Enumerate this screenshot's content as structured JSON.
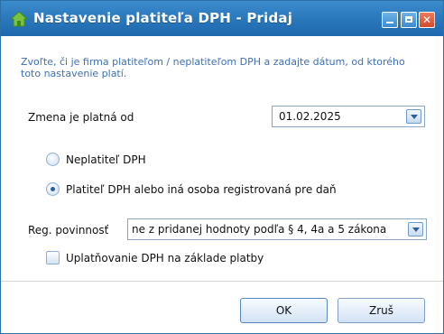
{
  "window": {
    "title": "Nastavenie platiteľa DPH - Pridaj"
  },
  "info_text": "Zvoľte, či je firma platiteľom / neplatiteľom DPH a zadajte dátum, od ktorého toto nastavenie platí.",
  "date_field": {
    "label": "Zmena je platná od",
    "value": "01.02.2025"
  },
  "vat_status": {
    "options": [
      {
        "label": "Neplatiteľ DPH",
        "checked": false
      },
      {
        "label": "Platiteľ DPH alebo iná osoba registrovaná pre daň",
        "checked": true
      }
    ]
  },
  "registration": {
    "label": "Reg. povinnosť",
    "value": "ne z pridanej hodnoty podľa § 4, 4a a 5 zákona"
  },
  "cash_accounting": {
    "label": "Uplatňovanie DPH na základe platby",
    "checked": false
  },
  "buttons": {
    "ok": "OK",
    "cancel": "Zruš"
  },
  "colors": {
    "title_bar": "#2a78bc",
    "info_text": "#3e6fb7",
    "close_button": "#d44a2a"
  }
}
